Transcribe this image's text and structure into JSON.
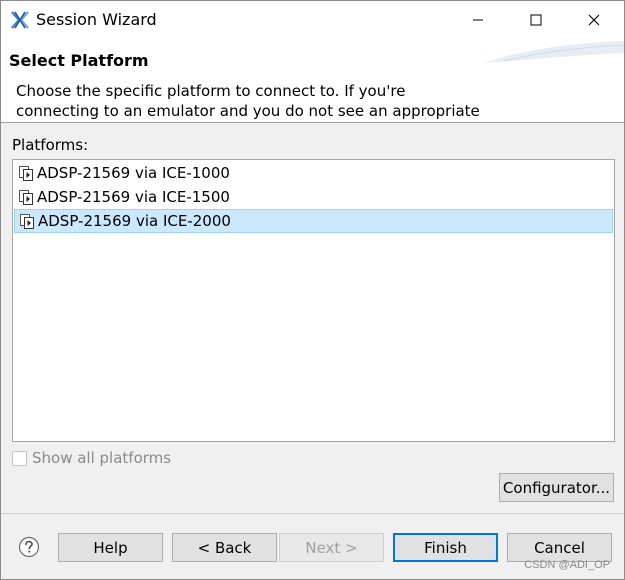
{
  "window": {
    "title": "Session Wizard",
    "icon": "app-x-logo-icon"
  },
  "banner": {
    "title": "Select Platform",
    "message": "Choose the specific platform to connect to.  If you're\nconnecting to an emulator and you do not see an appropriate"
  },
  "platforms": {
    "label": "Platforms:",
    "items": [
      {
        "label": "ADSP-21569 via ICE-1000",
        "icon": "platform-icon",
        "selected": false
      },
      {
        "label": "ADSP-21569 via ICE-1500",
        "icon": "platform-icon",
        "selected": false
      },
      {
        "label": "ADSP-21569 via ICE-2000",
        "icon": "platform-icon",
        "selected": true
      }
    ],
    "show_all_label": "Show all platforms",
    "show_all_checked": false,
    "show_all_enabled": false,
    "configurator_label": "Configurator..."
  },
  "footer": {
    "help_label": "Help",
    "back_label": "< Back",
    "next_label": "Next >",
    "next_enabled": false,
    "finish_label": "Finish",
    "cancel_label": "Cancel"
  },
  "watermark": "CSDN @ADI_OP",
  "colors": {
    "selection_bg": "#cce8ff",
    "selection_border": "#99d1ff",
    "primary_border": "#0078d7",
    "disabled_text": "#a0a0a0"
  }
}
